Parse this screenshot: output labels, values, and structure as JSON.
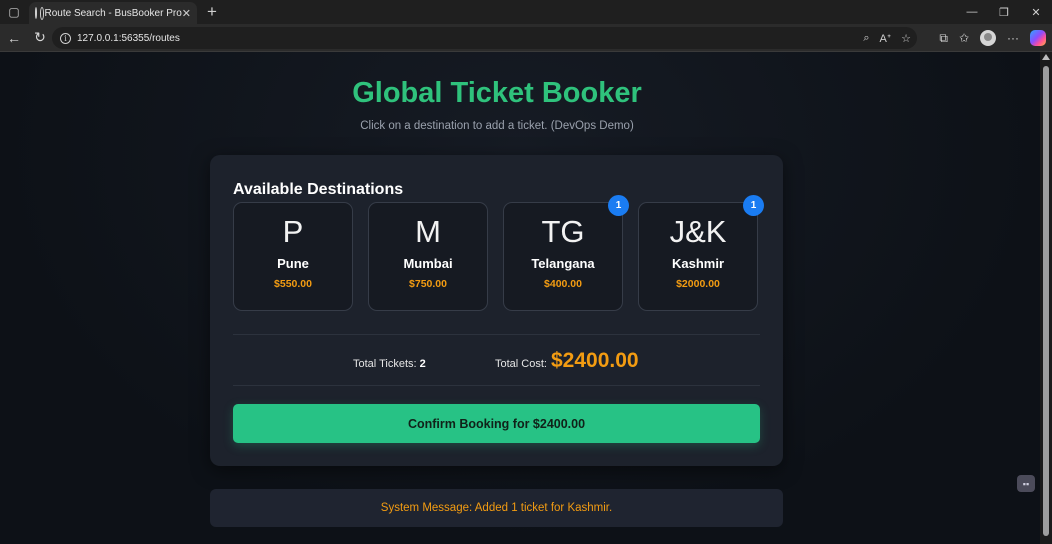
{
  "browser": {
    "tab_title": "Route Search - BusBooker Pro",
    "tab_close": "✕",
    "new_tab": "+",
    "url": "127.0.0.1:56355/routes",
    "window_controls": {
      "minimize": "—",
      "maximize": "❐",
      "close": "✕"
    },
    "nav": {
      "back": "←",
      "refresh": "↻"
    },
    "address_icons": {
      "zoom": "⌕",
      "read_aloud": "Aᐩ",
      "favorite": "☆"
    },
    "toolbar_icons": {
      "extensions": "⧉",
      "favorites": "✩",
      "more": "···"
    }
  },
  "page": {
    "title": "Global Ticket Booker",
    "subtitle": "Click on a destination to add a ticket. (DevOps Demo)",
    "section_title": "Available Destinations",
    "destinations": [
      {
        "code": "P",
        "name": "Pune",
        "price": "$550.00",
        "count": ""
      },
      {
        "code": "M",
        "name": "Mumbai",
        "price": "$750.00",
        "count": ""
      },
      {
        "code": "TG",
        "name": "Telangana",
        "price": "$400.00",
        "count": "1"
      },
      {
        "code": "J&K",
        "name": "Kashmir",
        "price": "$2000.00",
        "count": "1"
      }
    ],
    "totals": {
      "tickets_label": "Total Tickets:",
      "tickets_value": "2",
      "cost_label": "Total Cost:",
      "cost_value": "$2400.00"
    },
    "confirm_button": "Confirm Booking for $2400.00",
    "system_message": "System Message: Added 1 ticket for Kashmir."
  },
  "colors": {
    "accent_green": "#2fc27c",
    "button_green": "#27c285",
    "price_orange": "#f39c12",
    "badge_blue": "#1a7cf2",
    "background": "#0d1117"
  }
}
